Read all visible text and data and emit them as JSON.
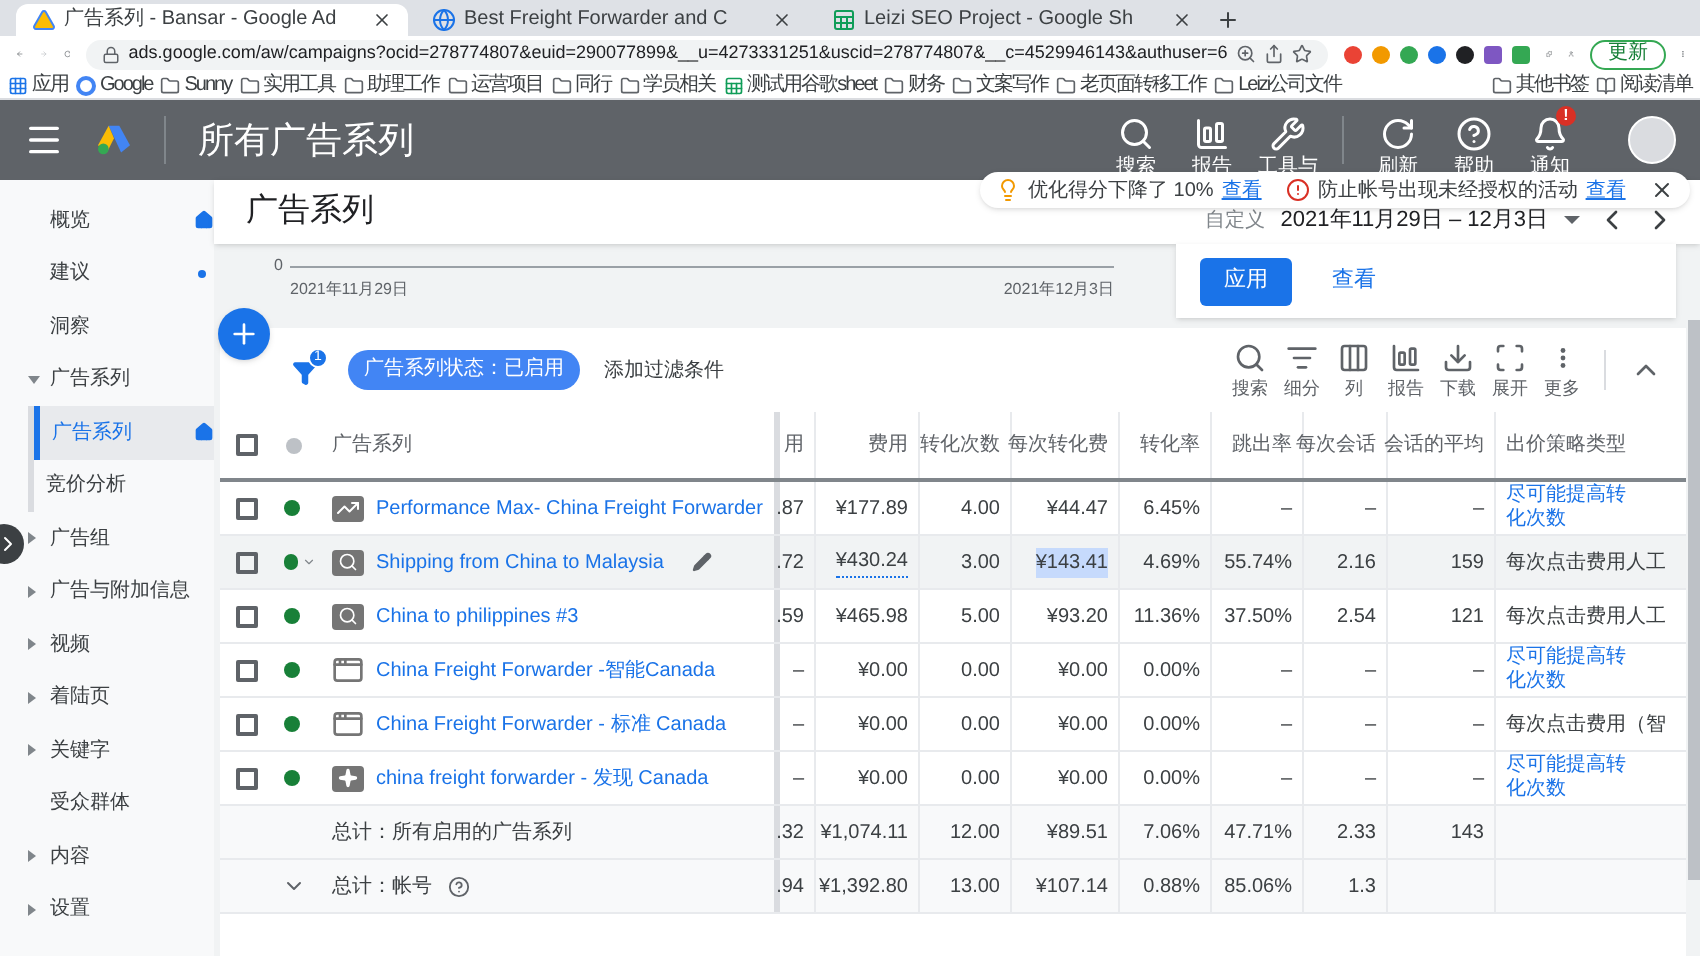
{
  "browser": {
    "tabs": [
      {
        "title": "广告系列 - Bansar - Google Ad",
        "selected": true
      },
      {
        "title": "Best Freight Forwarder and C",
        "selected": false
      },
      {
        "title": "Leizi SEO Project - Google Sh",
        "selected": false
      }
    ],
    "url": "ads.google.com/aw/campaigns?ocid=278774807&euid=290077899&__u=4273331251&uscid=278774807&__c=4529946143&authuser=6",
    "update_button": "更新",
    "bookmarks": [
      {
        "label": "应用",
        "kind": "apps"
      },
      {
        "label": "Google",
        "kind": "google"
      },
      {
        "label": "Sunny",
        "kind": "folder"
      },
      {
        "label": "实用工具",
        "kind": "folder"
      },
      {
        "label": "助理工作",
        "kind": "folder"
      },
      {
        "label": "运营项目",
        "kind": "folder"
      },
      {
        "label": "同行",
        "kind": "folder"
      },
      {
        "label": "学员相关",
        "kind": "folder"
      },
      {
        "label": "测试用谷歌sheet",
        "kind": "sheet"
      },
      {
        "label": "财务",
        "kind": "folder"
      },
      {
        "label": "文案写作",
        "kind": "folder"
      },
      {
        "label": "老页面转移工作",
        "kind": "folder"
      },
      {
        "label": "Leizi公司文件",
        "kind": "folder"
      }
    ],
    "bookmarks_right": [
      {
        "label": "其他书签",
        "kind": "folder"
      },
      {
        "label": "阅读清单",
        "kind": "reading"
      }
    ]
  },
  "header": {
    "title": "所有广告系列",
    "actions": [
      {
        "label": "搜索",
        "kind": "search"
      },
      {
        "label": "报告",
        "kind": "report"
      },
      {
        "label": "工具与",
        "kind": "tools"
      },
      {
        "label": "刷新",
        "kind": "refresh"
      },
      {
        "label": "帮助",
        "kind": "help"
      },
      {
        "label": "通知",
        "kind": "bell",
        "badge": "!"
      }
    ]
  },
  "notices": [
    {
      "kind": "tip",
      "text": "优化得分下降了 10%",
      "link": "查看"
    },
    {
      "kind": "alert",
      "text": "防止帐号出现未经授权的活动",
      "link": "查看"
    }
  ],
  "sidebar": {
    "items": [
      {
        "label": "概览",
        "selected": false,
        "pinned": true,
        "has_update": false
      },
      {
        "label": "建议",
        "selected": false,
        "pinned": false,
        "has_update": true
      },
      {
        "label": "洞察",
        "selected": false,
        "pinned": false,
        "has_update": false
      },
      {
        "label": "广告系列",
        "selected": false,
        "pinned": false,
        "has_update": false,
        "expanded": true,
        "children": [
          {
            "label": "广告系列",
            "selected": true,
            "pinned": true,
            "has_update": false
          },
          {
            "label": "竞价分析",
            "selected": false,
            "pinned": false,
            "has_update": false
          }
        ]
      },
      {
        "label": "广告组",
        "selected": false,
        "pinned": false,
        "has_update": false,
        "expanded": false
      },
      {
        "label": "广告与附加信息",
        "selected": false,
        "pinned": false,
        "has_update": false,
        "expanded": false
      },
      {
        "label": "视频",
        "selected": false,
        "pinned": false,
        "has_update": false,
        "expanded": false
      },
      {
        "label": "着陆页",
        "selected": false,
        "pinned": false,
        "has_update": false,
        "expanded": false
      },
      {
        "label": "关键字",
        "selected": false,
        "pinned": false,
        "has_update": false,
        "expanded": false
      },
      {
        "label": "受众群体",
        "selected": false,
        "pinned": false,
        "has_update": false
      },
      {
        "label": "内容",
        "selected": false,
        "pinned": false,
        "has_update": false,
        "expanded": false
      },
      {
        "label": "设置",
        "selected": false,
        "pinned": false,
        "has_update": false,
        "expanded": false
      }
    ]
  },
  "page": {
    "title": "广告系列",
    "date_label": "自定义",
    "date_range": "2021年11月29日 – 12月3日"
  },
  "chart": {
    "y_tick": "0",
    "start_label": "2021年11月29日",
    "end_label": "2021年12月3日"
  },
  "apply_card": {
    "primary": "应用",
    "secondary": "查看"
  },
  "filters": {
    "count": "1",
    "chip": "广告系列状态：已启用",
    "add": "添加过滤条件"
  },
  "toolbar": [
    {
      "label": "搜索",
      "kind": "search"
    },
    {
      "label": "细分",
      "kind": "segment"
    },
    {
      "label": "列",
      "kind": "columns"
    },
    {
      "label": "报告",
      "kind": "report"
    },
    {
      "label": "下载",
      "kind": "download"
    },
    {
      "label": "展开",
      "kind": "expand"
    },
    {
      "label": "更多",
      "kind": "more"
    }
  ],
  "table": {
    "all_checked": false,
    "columns": [
      "广告系列",
      "用",
      "费用",
      "转化次数",
      "每次转化费",
      "转化率",
      "跳出率",
      "每次会话",
      "会话的平均",
      "出价策略类型"
    ],
    "rows": [
      {
        "checked": false,
        "kind": "performance",
        "name": "Performance Max- China Freight Forwarder",
        "cut": ".87",
        "cost": "¥177.89",
        "conversions": "4.00",
        "cpa": "¥44.47",
        "conv_rate": "6.45%",
        "bounce": "–",
        "pages": "–",
        "duration": "–",
        "bidding": "尽可能提高转化次数",
        "bidding_link": true,
        "hovered": false
      },
      {
        "checked": false,
        "kind": "search",
        "name": "Shipping from China to Malaysia",
        "cut": ".72",
        "cost": "¥430.24",
        "conversions": "3.00",
        "cpa": "¥143.41",
        "conv_rate": "4.69%",
        "bounce": "55.74%",
        "pages": "2.16",
        "duration": "159",
        "bidding": "每次点击费用人工",
        "bidding_link": false,
        "hovered": true
      },
      {
        "checked": false,
        "kind": "search",
        "name": "China to philippines #3",
        "cut": ".59",
        "cost": "¥465.98",
        "conversions": "5.00",
        "cpa": "¥93.20",
        "conv_rate": "11.36%",
        "bounce": "37.50%",
        "pages": "2.54",
        "duration": "121",
        "bidding": "每次点击费用人工",
        "bidding_link": false,
        "hovered": false
      },
      {
        "checked": false,
        "kind": "display",
        "name": "China Freight Forwarder -智能Canada",
        "cut": "–",
        "cost": "¥0.00",
        "conversions": "0.00",
        "cpa": "¥0.00",
        "conv_rate": "0.00%",
        "bounce": "–",
        "pages": "–",
        "duration": "–",
        "bidding": "尽可能提高转化次数",
        "bidding_link": true,
        "hovered": false
      },
      {
        "checked": false,
        "kind": "display",
        "name": "China Freight Forwarder - 标准 Canada",
        "cut": "–",
        "cost": "¥0.00",
        "conversions": "0.00",
        "cpa": "¥0.00",
        "conv_rate": "0.00%",
        "bounce": "–",
        "pages": "–",
        "duration": "–",
        "bidding": "每次点击费用（智",
        "bidding_link": false,
        "hovered": false
      },
      {
        "checked": false,
        "kind": "discovery",
        "name": "china freight forwarder - 发现 Canada",
        "cut": "–",
        "cost": "¥0.00",
        "conversions": "0.00",
        "cpa": "¥0.00",
        "conv_rate": "0.00%",
        "bounce": "–",
        "pages": "–",
        "duration": "–",
        "bidding": "尽可能提高转化次数",
        "bidding_link": true,
        "hovered": false
      }
    ],
    "totals": [
      {
        "label": "总计：所有启用的广告系列",
        "cut": ".32",
        "cost": "¥1,074.11",
        "conversions": "12.00",
        "cpa": "¥89.51",
        "conv_rate": "7.06%",
        "bounce": "47.71%",
        "pages": "2.33",
        "duration": "143",
        "expandable": false
      },
      {
        "label": "总计：帐号",
        "cut": ".94",
        "cost": "¥1,392.80",
        "conversions": "13.00",
        "cpa": "¥107.14",
        "conv_rate": "0.88%",
        "bounce": "85.06%",
        "pages": "1.3",
        "expandable": true
      }
    ]
  }
}
